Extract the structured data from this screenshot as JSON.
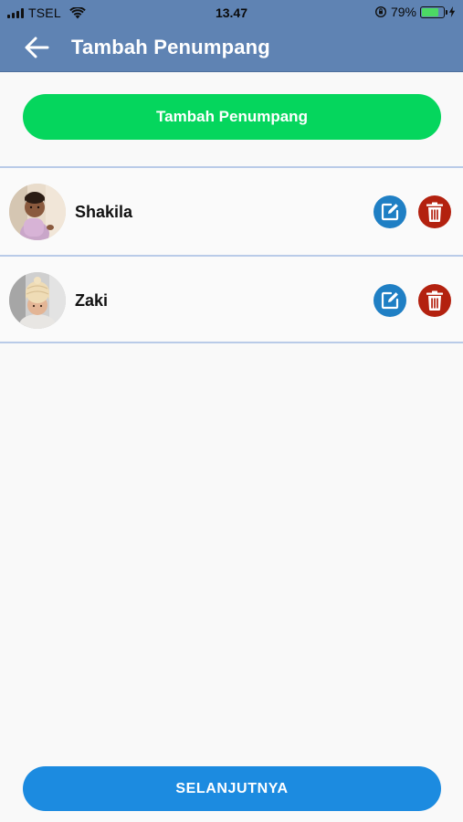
{
  "status_bar": {
    "carrier": "TSEL",
    "time": "13.47",
    "battery_percent": "79%",
    "battery_level": 0.79,
    "icons": [
      "signal-icon",
      "wifi-icon",
      "orientation-lock-icon",
      "battery-icon",
      "charging-bolt-icon"
    ]
  },
  "nav": {
    "back_icon": "arrow-left-icon",
    "title": "Tambah Penumpang"
  },
  "add_button": {
    "label": "Tambah Penumpang"
  },
  "passengers": [
    {
      "name": "Shakila",
      "edit_icon": "edit-icon",
      "delete_icon": "trash-icon"
    },
    {
      "name": "Zaki",
      "edit_icon": "edit-icon",
      "delete_icon": "trash-icon"
    }
  ],
  "next_button": {
    "label": "SELANJUTNYA"
  },
  "colors": {
    "header": "#5f83b3",
    "add_button": "#05d65d",
    "next_button": "#1c8be0",
    "edit": "#1f7fc4",
    "delete": "#b3210f",
    "divider": "#b9cbe8"
  }
}
